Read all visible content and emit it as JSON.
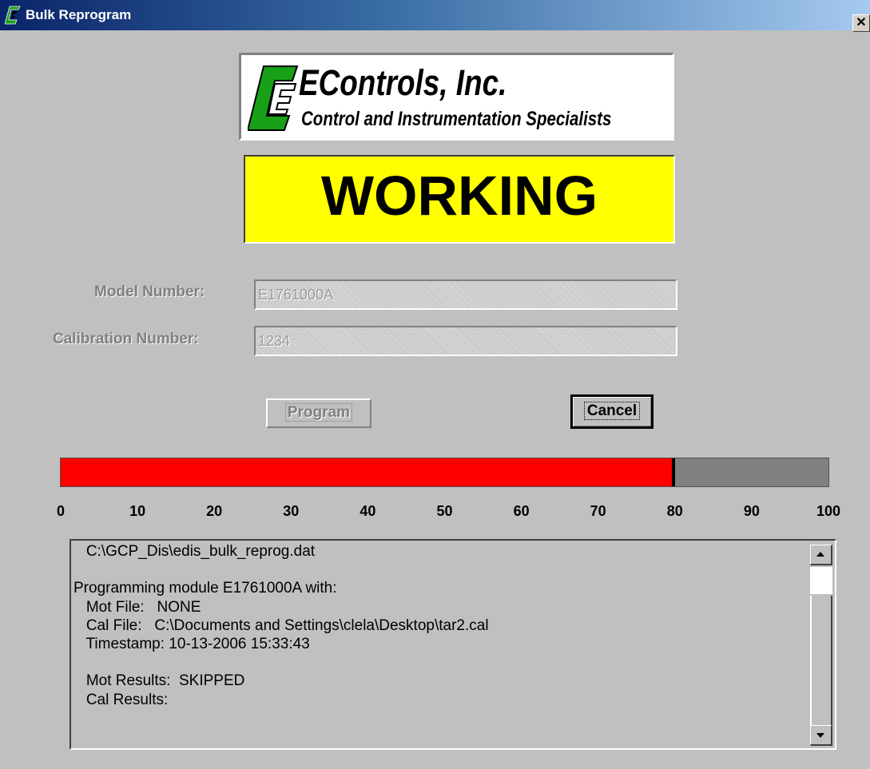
{
  "window": {
    "title": "Bulk Reprogram",
    "close_label": "✕"
  },
  "logo": {
    "company": "EControls, Inc.",
    "tagline": "Control and Instrumentation Specialists"
  },
  "status": {
    "text": "WORKING",
    "background_color": "#ffff00"
  },
  "form": {
    "model_label": "Model Number:",
    "model_value": "E1761000A",
    "calibration_label": "Calibration Number:",
    "calibration_value": "1234"
  },
  "buttons": {
    "program_label": "Program",
    "program_enabled": false,
    "cancel_label": "Cancel"
  },
  "progress": {
    "value_percent": 80,
    "fill_color": "#ff0000",
    "scale": [
      "0",
      "10",
      "20",
      "30",
      "40",
      "50",
      "60",
      "70",
      "80",
      "90",
      "100"
    ]
  },
  "log": {
    "lines": [
      "   C:\\GCP_Dis\\edis_bulk_reprog.dat",
      "",
      "Programming module E1761000A with:",
      "   Mot File:   NONE",
      "   Cal File:   C:\\Documents and Settings\\clela\\Desktop\\tar2.cal",
      "   Timestamp: 10-13-2006 15:33:43",
      "",
      "   Mot Results:  SKIPPED",
      "   Cal Results:"
    ]
  }
}
